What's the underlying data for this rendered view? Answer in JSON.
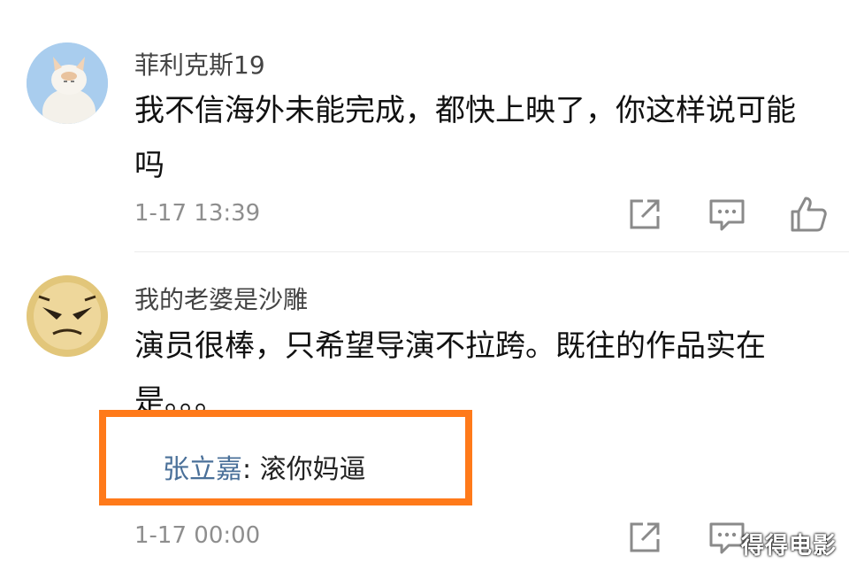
{
  "comments": [
    {
      "username": "菲利克斯19",
      "text": "我不信海外未能完成，都快上映了，你这样说可能吗",
      "time": "1-17 13:39"
    },
    {
      "username": "我的老婆是沙雕",
      "text": "演员很棒，只希望导演不拉跨。既往的作品实在是。。。",
      "reply": {
        "name": "张立嘉",
        "separator": ": ",
        "text": "滚你妈逼"
      },
      "time": "1-17 00:00"
    }
  ],
  "colors": {
    "highlight_border": "#ff7a1a",
    "reply_name": "#4a7099"
  },
  "icons": [
    "share-icon",
    "comment-icon",
    "thumbs-up-icon"
  ],
  "watermark": "得得电影"
}
